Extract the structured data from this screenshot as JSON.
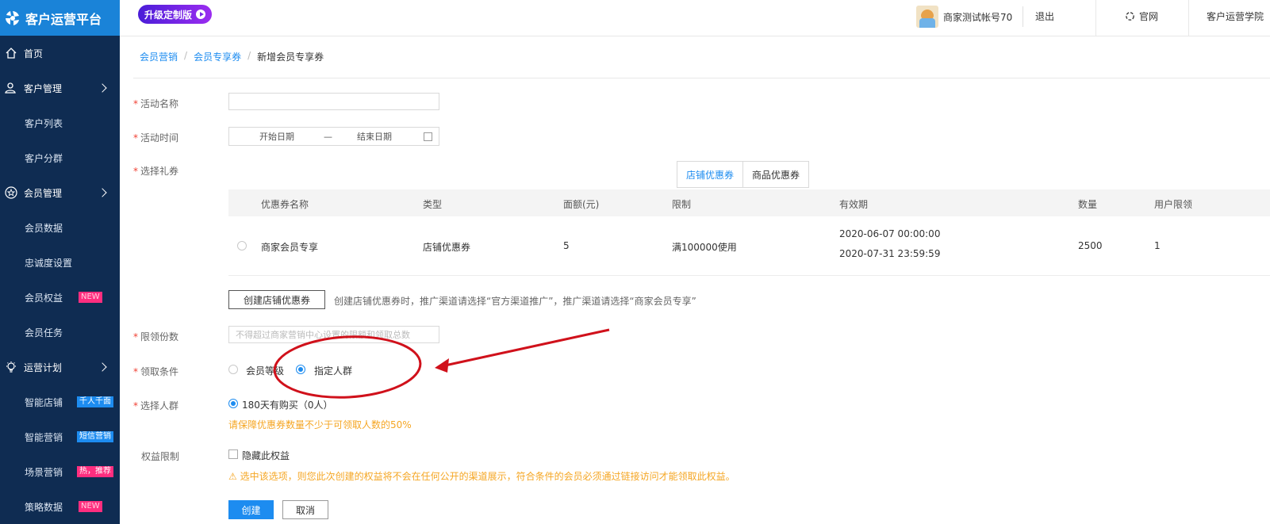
{
  "app": {
    "title": "客户运营平台"
  },
  "sidebar": {
    "items": [
      {
        "label": "首页",
        "type": "top",
        "icon": "home-icon"
      },
      {
        "label": "客户管理",
        "type": "top",
        "icon": "user-icon",
        "expand": true
      },
      {
        "label": "客户列表",
        "type": "sub"
      },
      {
        "label": "客户分群",
        "type": "sub"
      },
      {
        "label": "会员管理",
        "type": "top",
        "icon": "star-icon",
        "expand": true
      },
      {
        "label": "会员数据",
        "type": "sub"
      },
      {
        "label": "忠诚度设置",
        "type": "sub"
      },
      {
        "label": "会员权益",
        "type": "sub",
        "badge": "NEW"
      },
      {
        "label": "会员任务",
        "type": "sub"
      },
      {
        "label": "运营计划",
        "type": "top",
        "icon": "bulb-icon",
        "expand": true
      },
      {
        "label": "智能店铺",
        "type": "sub",
        "badge": "千人千面"
      },
      {
        "label": "智能营销",
        "type": "sub",
        "badge": "短信营销"
      },
      {
        "label": "场景营销",
        "type": "sub",
        "badge": "热，推荐"
      },
      {
        "label": "策略数据",
        "type": "sub",
        "badge": "NEW"
      }
    ]
  },
  "header": {
    "upgrade_label": "升级定制版",
    "account_name": "商家测试帐号70",
    "logout": "退出",
    "official_site": "官网",
    "academy": "客户运营学院"
  },
  "breadcrumb": {
    "level1": "会员营销",
    "level2": "会员专享券",
    "current": "新增会员专享券"
  },
  "form": {
    "activity_name_label": "活动名称",
    "activity_time_label": "活动时间",
    "start_date_placeholder": "开始日期",
    "range_separator": "—",
    "end_date_placeholder": "结束日期",
    "select_coupon_label": "选择礼券",
    "coupon_tabs": [
      "店铺优惠券",
      "商品优惠券"
    ],
    "table": {
      "headers": [
        "优惠券名称",
        "类型",
        "面额(元)",
        "限制",
        "有效期",
        "数量",
        "用户限领"
      ],
      "rows": [
        {
          "name": "商家会员专享",
          "type": "店铺优惠券",
          "amount": "5",
          "limit": "满100000使用",
          "valid_from": "2020-06-07 00:00:00",
          "valid_to": "2020-07-31 23:59:59",
          "quantity": "2500",
          "user_limit": "1"
        }
      ]
    },
    "create_coupon_button": "创建店铺优惠券",
    "create_coupon_hint": "创建店铺优惠券时，推广渠道请选择“官方渠道推广”，推广渠道请选择“商家会员专享”",
    "limit_count_label": "限领份数",
    "limit_count_placeholder": "不得超过商家营销中心设置的限额和领取总数",
    "condition_label": "领取条件",
    "condition_options": [
      "会员等级",
      "指定人群"
    ],
    "condition_selected": "指定人群",
    "audience_label": "选择人群",
    "audience_option": "180天有购买（0人）",
    "audience_warning": "请保障优惠券数量不少于可领取人数的50%",
    "rights_label": "权益限制",
    "hide_rights_label": "隐藏此权益",
    "hide_rights_warning": "⚠ 选中该选项，则您此次创建的权益将不会在任何公开的渠道展示，符合条件的会员必须通过链接访问才能领取此权益。",
    "submit_button": "创建",
    "cancel_button": "取消"
  },
  "colors": {
    "sidebar_bg": "#0f2c52",
    "accent": "#1d8cf0",
    "warning": "#f5a623",
    "required": "#f04134",
    "annotation": "#d0111b"
  }
}
